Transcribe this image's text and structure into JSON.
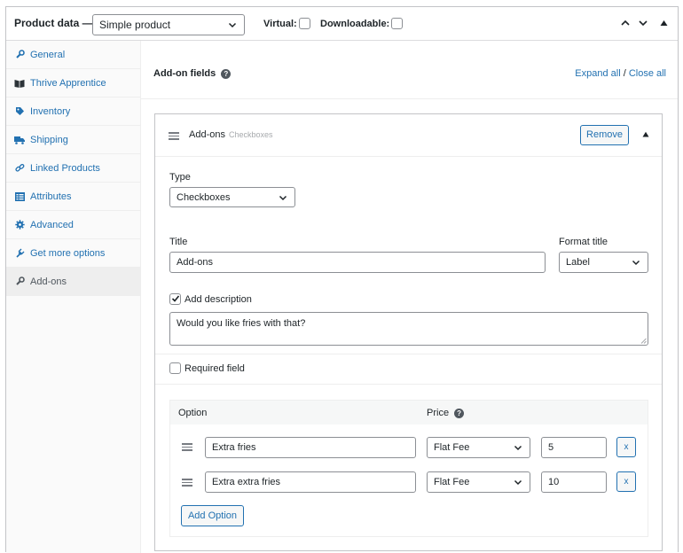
{
  "header": {
    "title": "Product data —",
    "product_type": "Simple product",
    "virtual_label": "Virtual:",
    "downloadable_label": "Downloadable:"
  },
  "sidebar": {
    "items": [
      {
        "label": "General",
        "icon": "wrench-icon"
      },
      {
        "label": "Thrive Apprentice",
        "icon": "book-icon"
      },
      {
        "label": "Inventory",
        "icon": "tag-icon"
      },
      {
        "label": "Shipping",
        "icon": "truck-icon"
      },
      {
        "label": "Linked Products",
        "icon": "link-icon"
      },
      {
        "label": "Attributes",
        "icon": "list-icon"
      },
      {
        "label": "Advanced",
        "icon": "gear-icon"
      },
      {
        "label": "Get more options",
        "icon": "plugin-icon"
      },
      {
        "label": "Add-ons",
        "icon": "wrench-icon"
      }
    ],
    "active": "Add-ons"
  },
  "addon_fields": {
    "label": "Add-on fields",
    "expand_all": "Expand all",
    "separator": " / ",
    "close_all": "Close all"
  },
  "addon": {
    "name": "Add-ons",
    "type_hint": "Checkboxes",
    "remove_label": "Remove",
    "type_label": "Type",
    "type_value": "Checkboxes",
    "title_label": "Title",
    "title_value": "Add-ons",
    "format_title_label": "Format title",
    "format_title_value": "Label",
    "add_description_label": "Add description",
    "add_description_checked": true,
    "description_value": "Would you like fries with that?",
    "required_label": "Required field",
    "required_checked": false
  },
  "options": {
    "option_header": "Option",
    "price_header": "Price",
    "rows": [
      {
        "label": "Extra fries",
        "price_type": "Flat Fee",
        "price": "5",
        "remove": "x"
      },
      {
        "label": "Extra extra fries",
        "price_type": "Flat Fee",
        "price": "10",
        "remove": "x"
      }
    ],
    "add_option_label": "Add Option"
  },
  "colors": {
    "link": "#2271b1",
    "border": "#c3c4c7",
    "sidebar_bg": "#fafafa",
    "active_bg": "#eeeeee"
  }
}
